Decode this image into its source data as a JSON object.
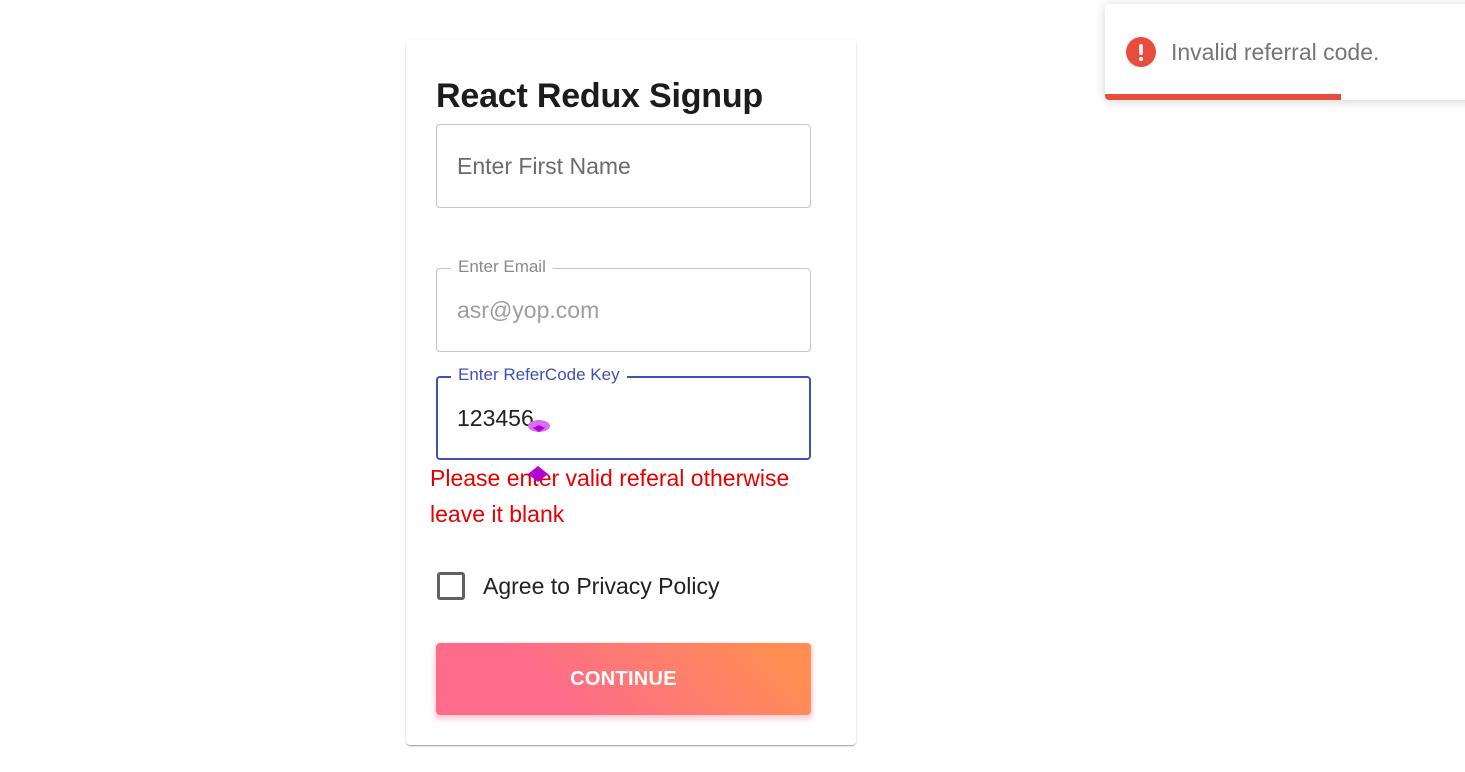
{
  "form": {
    "title": "React Redux Signup",
    "first_name": {
      "placeholder": "Enter First Name",
      "value": ""
    },
    "email": {
      "label": "Enter Email",
      "value": "asr@yop.com"
    },
    "refer_code": {
      "label": "Enter ReferCode Key",
      "value": "123456"
    },
    "error_message": "Please enter valid referal otherwise leave it blank",
    "privacy_checkbox": {
      "label": "Agree to Privacy Policy",
      "checked": false
    },
    "continue_label": "CONTINUE"
  },
  "toast": {
    "message": "Invalid referral code.",
    "icon": "error-icon",
    "progress_remaining": 0.59
  },
  "colors": {
    "focus_accent": "#3f51b5",
    "error_text": "#e60000",
    "toast_error": "#e74c3c",
    "button_gradient_start": "#fe6b8b",
    "button_gradient_end": "#ff8e53"
  }
}
